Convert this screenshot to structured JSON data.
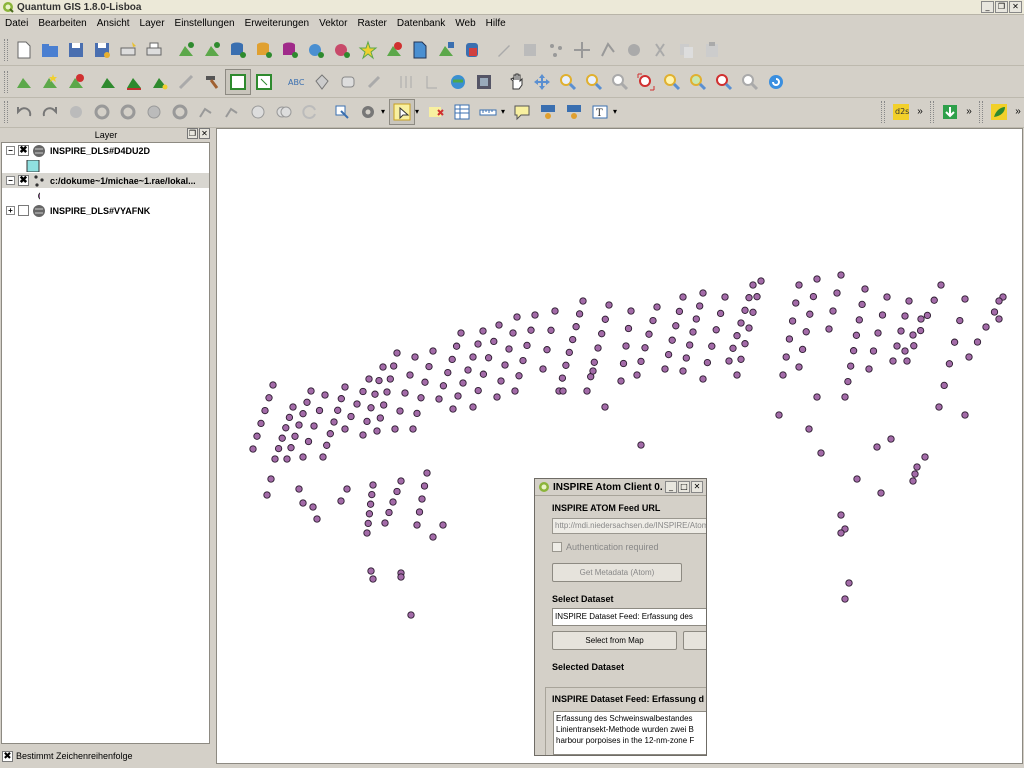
{
  "window": {
    "title": "Quantum GIS 1.8.0-Lisboa",
    "controls": [
      "_",
      "❐",
      "✕"
    ]
  },
  "menubar": {
    "items": [
      "Datei",
      "Bearbeiten",
      "Ansicht",
      "Layer",
      "Einstellungen",
      "Erweiterungen",
      "Vektor",
      "Raster",
      "Datenbank",
      "Web",
      "Hilfe"
    ]
  },
  "toolbar3": {
    "plugin_label": "d2s"
  },
  "layers_panel": {
    "title": "Layer",
    "items": [
      {
        "name": "INSPIRE_DLS#D4DU2D",
        "checked": true,
        "expanded": true
      },
      {
        "name": "c:/dokume~1/michae~1.rae/lokal...",
        "checked": true,
        "expanded": true
      },
      {
        "name": "INSPIRE_DLS#VYAFNK",
        "checked": false,
        "expanded": false
      }
    ],
    "footer": "Bestimmt Zeichenreihenfolge"
  },
  "map": {
    "point_fill": "#a36ba8",
    "point_stroke": "#2b1a2e",
    "background": "#ffffff"
  },
  "dialog": {
    "title": "INSPIRE Atom Client 0...",
    "feed_url_label": "INSPIRE ATOM Feed URL",
    "feed_url_value": "http://mdi.niedersachsen.de/INSPIRE/Atom",
    "auth_label": "Authentication required",
    "get_metadata_label": "Get Metadata (Atom)",
    "select_dataset_label": "Select Dataset",
    "dataset_value": "INSPIRE Dataset Feed: Erfassung des",
    "select_from_map_label": "Select from Map",
    "selected_dataset_label": "Selected Dataset",
    "selected_dataset_title": "INSPIRE Dataset Feed: Erfassung d",
    "description_lines": [
      "Erfassung des Schweinswalbestandes",
      "Linientransekt-Methode wurden zwei B",
      "harbour porpoises in the 12-nm-zone F"
    ]
  }
}
